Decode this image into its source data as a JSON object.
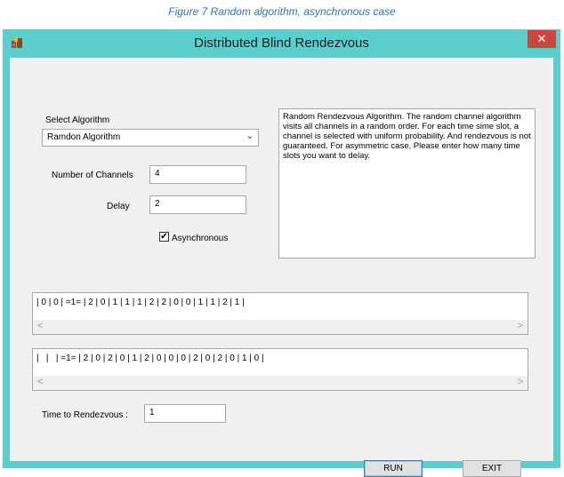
{
  "figure_caption": "Figure 7 Random algorithm, asynchronous case",
  "window": {
    "title": "Distributed Blind Rendezvous",
    "close_glyph": "✕"
  },
  "form": {
    "select_algorithm_label": "Select Algorithm",
    "algorithm_selected": "Ramdon Algorithm",
    "channels_label": "Number of Channels",
    "channels_value": "4",
    "delay_label": "Delay",
    "delay_value": "2",
    "async_label": "Asynchronous",
    "async_checked": true
  },
  "description": "Random Rendezvous Algorithm. The random channel algorithm visits all channels in a random order. For each time sime slot, a channel is selected with uniform probability. And rendezvous is not guaranteed. For asymmetric case, Please enter how many time slots you want to delay.",
  "sequences": {
    "user1": "| 0 | 0 | =1= | 2 | 0 | 1 | 1 | 1 | 2 | 2 | 0 | 0 | 1 | 1 | 2 | 1 |",
    "user2": "|   |   | =1= | 2 | 0 | 2 | 0 | 1 | 2 | 0 | 0 | 0 | 2 | 0 | 2 | 0 | 1 | 0 |"
  },
  "result": {
    "label": "Time to Rendezvous :",
    "value": "1"
  },
  "buttons": {
    "run": "RUN",
    "exit": "EXIT"
  },
  "scroll_glyphs": {
    "left": "<",
    "right": ">"
  },
  "colors": {
    "window_frame": "#5bcfd0",
    "close_button": "#c9473f",
    "caption": "#2e74b5"
  }
}
